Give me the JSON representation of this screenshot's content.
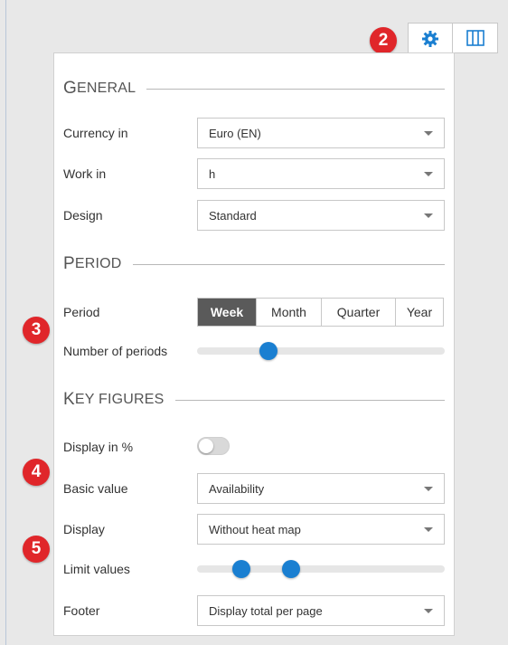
{
  "toolbar": {
    "settings_icon": "gear-icon",
    "columns_icon": "columns-icon"
  },
  "badges": [
    "2",
    "3",
    "4",
    "5"
  ],
  "sections": {
    "general": {
      "first": "G",
      "rest": "ENERAL"
    },
    "period": {
      "first": "P",
      "rest": "ERIOD"
    },
    "key_figures": {
      "first": "K",
      "rest": "EY FIGURES"
    }
  },
  "general": {
    "currency": {
      "label": "Currency in",
      "value": "Euro (EN)"
    },
    "work": {
      "label": "Work in",
      "value": "h"
    },
    "design": {
      "label": "Design",
      "value": "Standard"
    }
  },
  "period": {
    "period_label": "Period",
    "options": [
      "Week",
      "Month",
      "Quarter",
      "Year"
    ],
    "selected": "Week",
    "number_label": "Number of periods",
    "number_fraction": 0.29
  },
  "key_figures": {
    "display_percent": {
      "label": "Display in %",
      "on": false
    },
    "basic_value": {
      "label": "Basic value",
      "value": "Availability"
    },
    "display": {
      "label": "Display",
      "value": "Without heat map"
    },
    "limit_values": {
      "label": "Limit values",
      "low_fraction": 0.18,
      "high_fraction": 0.38
    },
    "footer": {
      "label": "Footer",
      "value": "Display total per page"
    }
  },
  "colors": {
    "accent": "#1a7fd1",
    "badge": "#e0262a",
    "segment_active": "#5a5a5a"
  }
}
